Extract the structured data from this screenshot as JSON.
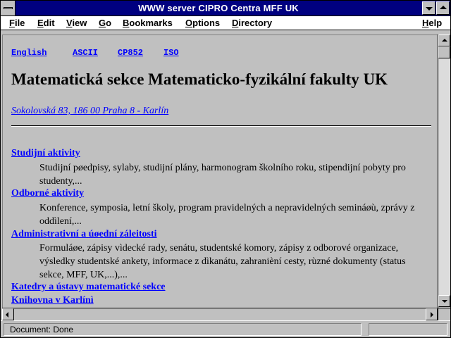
{
  "window": {
    "title": "WWW server CIPRO Centra MFF UK"
  },
  "menu": {
    "items": [
      {
        "first": "F",
        "rest": "ile"
      },
      {
        "first": "E",
        "rest": "dit"
      },
      {
        "first": "V",
        "rest": "iew"
      },
      {
        "first": "G",
        "rest": "o"
      },
      {
        "first": "B",
        "rest": "ookmarks"
      },
      {
        "first": "O",
        "rest": "ptions"
      },
      {
        "first": "D",
        "rest": "irectory"
      },
      {
        "first": "H",
        "rest": "elp"
      }
    ]
  },
  "page": {
    "languages": [
      "English",
      "ASCII",
      "CP852",
      "ISO"
    ],
    "heading": "Matematická sekce Matematicko-fyzikální fakulty UK",
    "address": "Sokolovská 83, 186 00 Praha 8 - Karlín",
    "entries": [
      {
        "link": "Studijní aktivity",
        "desc": "Studijní pøedpisy, sylaby, studijní plány, harmonogram školního roku, stipendijní pobyty pro studenty,..."
      },
      {
        "link": "Odborné aktivity",
        "desc": "Konference, symposia, letní školy, program pravidelných a nepravidelných semináøù, zprávy z oddìlení,..."
      },
      {
        "link": "Administrativní a úøední zále\u0010itosti",
        "desc": "Formuláøe, zápisy vìdecké rady, senátu, studentské komory, zápisy z odborové organizace, výsledky studentské ankety, informace z dìkanátu, zahranièní cesty, rùzné dokumenty (status sekce, MFF, UK,...),..."
      },
      {
        "link": "Katedry a ústavy matematické sekce",
        "desc": ""
      },
      {
        "link": "Knihovna v Karlínì",
        "desc": ""
      }
    ]
  },
  "status": {
    "text": "Document: Done"
  }
}
